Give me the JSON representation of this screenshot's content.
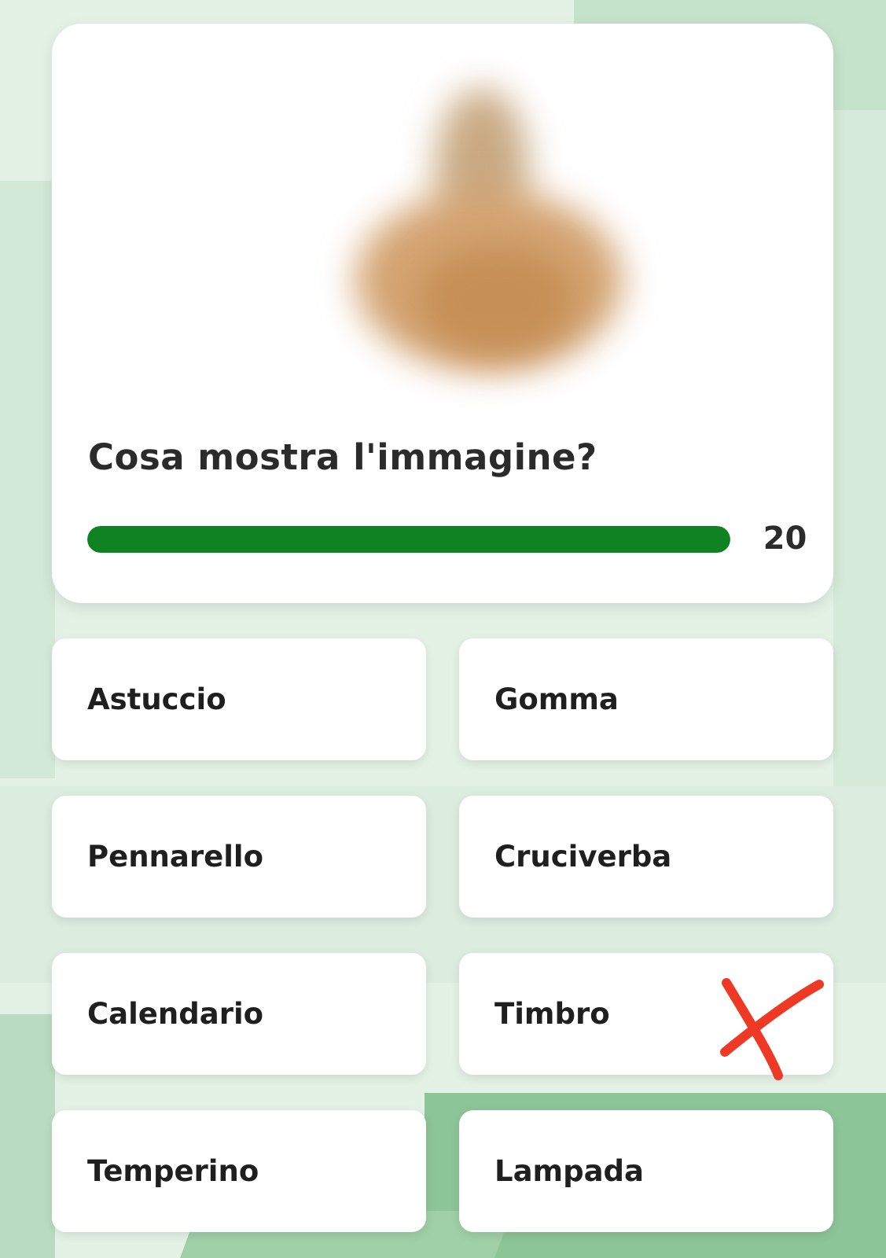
{
  "colors": {
    "accent": "#0f8222",
    "timer_track": "#e6e6e6",
    "mark": "#ee3a24",
    "background": "#d9ecdd"
  },
  "quiz": {
    "image_icon": "blurred-photo",
    "question": "Cosa mostra l'immagine?",
    "timer_value": "20",
    "timer_progress": 1.0,
    "answers": [
      {
        "label": "Astuccio"
      },
      {
        "label": "Gomma"
      },
      {
        "label": "Pennarello"
      },
      {
        "label": "Cruciverba"
      },
      {
        "label": "Calendario"
      },
      {
        "label": "Timbro",
        "mark": "x-mark-icon"
      },
      {
        "label": "Temperino"
      },
      {
        "label": "Lampada"
      }
    ]
  }
}
